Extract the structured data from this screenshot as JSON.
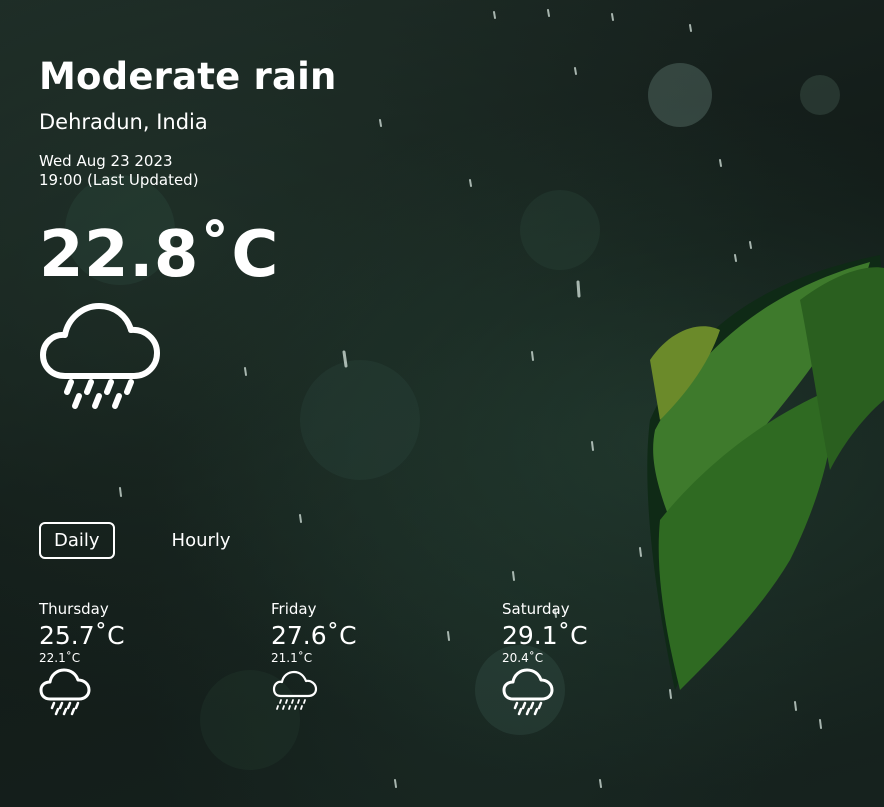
{
  "current": {
    "condition": "Moderate rain",
    "location": "Dehradun, India",
    "date": "Wed Aug 23 2023",
    "updated": "19:00 (Last Updated)",
    "temperature": "22.8˚C",
    "icon": "cloud-heavy-rain-icon"
  },
  "tabs": [
    {
      "label": "Daily",
      "active": true
    },
    {
      "label": "Hourly",
      "active": false
    }
  ],
  "forecast": [
    {
      "day": "Thursday",
      "max": "25.7˚C",
      "min": "22.1˚C",
      "icon": "cloud-rain-icon"
    },
    {
      "day": "Friday",
      "max": "27.6˚C",
      "min": "21.1˚C",
      "icon": "cloud-drizzle-icon"
    },
    {
      "day": "Saturday",
      "max": "29.1˚C",
      "min": "20.4˚C",
      "icon": "cloud-rain-icon"
    }
  ]
}
